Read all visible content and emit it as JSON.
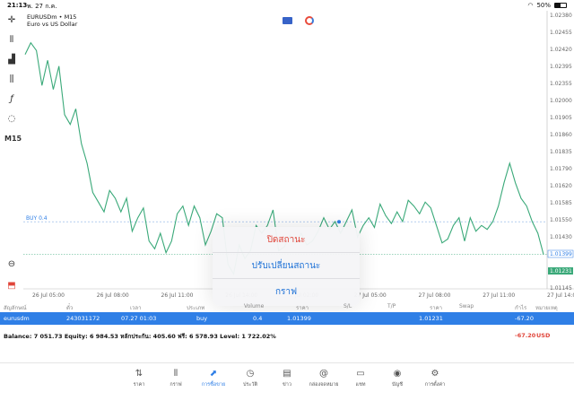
{
  "status_bar": {
    "time": "21:13",
    "date": "พ. 27 ก.ค.",
    "battery": "50%",
    "battery_level": 0.5
  },
  "toolbar": {
    "icons": [
      "crosshair-icon",
      "candles-icon",
      "indicators-icon",
      "settings-sliders-icon",
      "function-icon",
      "shapes-icon"
    ],
    "timeframe": "M15",
    "bottom_icons": [
      "zoom-icon",
      "trade-icon"
    ]
  },
  "chart": {
    "symbol": "EURUSDm • M15",
    "description": "Euro vs US Dollar",
    "line_color": "#3aa979",
    "price_ticks": [
      "1.02380",
      "1.02455",
      "1.02420",
      "1.02395",
      "1.02355",
      "1.02000",
      "1.01905",
      "1.01860",
      "1.01835",
      "1.01790",
      "1.01620",
      "1.01585",
      "1.01550",
      "1.01430",
      "1.01399",
      "1.01231",
      "1.01145"
    ],
    "price_highlights": {
      "buy_level": "1.01399",
      "current": "1.01231"
    },
    "buy_label": "BUY 0.4",
    "time_ticks": [
      "26 Jul 05:00",
      "26 Jul 08:00",
      "26 Jul 11:00",
      "26 Jul 14:00",
      "7 Jul 02:00",
      "27 Jul 05:00",
      "27 Jul 08:00",
      "27 Jul 11:00",
      "27 Jul 14:00"
    ],
    "series": [
      1.0226,
      1.0232,
      1.0228,
      1.021,
      1.0223,
      1.0208,
      1.022,
      1.0195,
      1.019,
      1.0198,
      1.018,
      1.017,
      1.0155,
      1.015,
      1.0145,
      1.0156,
      1.0152,
      1.0145,
      1.0152,
      1.0135,
      1.0142,
      1.0147,
      1.013,
      1.0126,
      1.0134,
      1.0124,
      1.013,
      1.0144,
      1.0148,
      1.0138,
      1.0148,
      1.0142,
      1.0128,
      1.0135,
      1.0144,
      1.0142,
      1.0118,
      1.0113,
      1.0128,
      1.0121,
      1.0125,
      1.0138,
      1.0134,
      1.0138,
      1.0146,
      1.0125,
      1.0127,
      1.0133,
      1.0129,
      1.0134,
      1.0128,
      1.013,
      1.0135,
      1.0142,
      1.0136,
      1.014,
      1.0134,
      1.014,
      1.0146,
      1.0132,
      1.0138,
      1.0142,
      1.0137,
      1.0149,
      1.0143,
      1.0139,
      1.0145,
      1.014,
      1.0151,
      1.0148,
      1.0144,
      1.015,
      1.0147,
      1.0138,
      1.0129,
      1.0131,
      1.0138,
      1.0142,
      1.013,
      1.0142,
      1.0135,
      1.0138,
      1.0136,
      1.014,
      1.0148,
      1.016,
      1.017,
      1.016,
      1.0152,
      1.0148,
      1.014,
      1.0134,
      1.01231
    ]
  },
  "popup_menu": {
    "items": [
      "ปิดสถานะ",
      "ปรับเปลี่ยนสถานะ",
      "กราฟ"
    ]
  },
  "table": {
    "headers": [
      "สัญลักษณ์",
      "ตั๋ว",
      "เวลา",
      "ประเภท",
      "Volume",
      "ราคา",
      "S/L",
      "T/P",
      "ราคา",
      "Swap",
      "กำไร",
      "หมายเหตุ"
    ],
    "row": {
      "symbol": "eurusdm",
      "ticket": "243031172",
      "time": "07.27 01:03",
      "type": "buy",
      "volume": "0.4",
      "open_price": "1.01399",
      "price": "1.01231",
      "profit": "-67.20"
    },
    "balance_text": "Balance: 7 051.73 Equity: 6 984.53 หลักประกัน: 405.60 ฟรี: 6 578.93 Level: 1 722.02%",
    "total_profit": "-67.20",
    "currency": "USD"
  },
  "nav": {
    "items": [
      {
        "label": "ราคา",
        "icon": "quotes-icon"
      },
      {
        "label": "กราฟ",
        "icon": "chart-icon"
      },
      {
        "label": "การซื้อขาย",
        "icon": "trade-icon"
      },
      {
        "label": "ประวัติ",
        "icon": "history-icon"
      },
      {
        "label": "ข่าว",
        "icon": "news-icon"
      },
      {
        "label": "กล่องจดหมาย",
        "icon": "mailbox-icon"
      },
      {
        "label": "แชท",
        "icon": "chat-icon"
      },
      {
        "label": "บัญชี",
        "icon": "account-icon"
      },
      {
        "label": "การตั้งค่า",
        "icon": "settings-icon"
      }
    ],
    "active_index": 2,
    "active_color": "#2f7fe6"
  }
}
